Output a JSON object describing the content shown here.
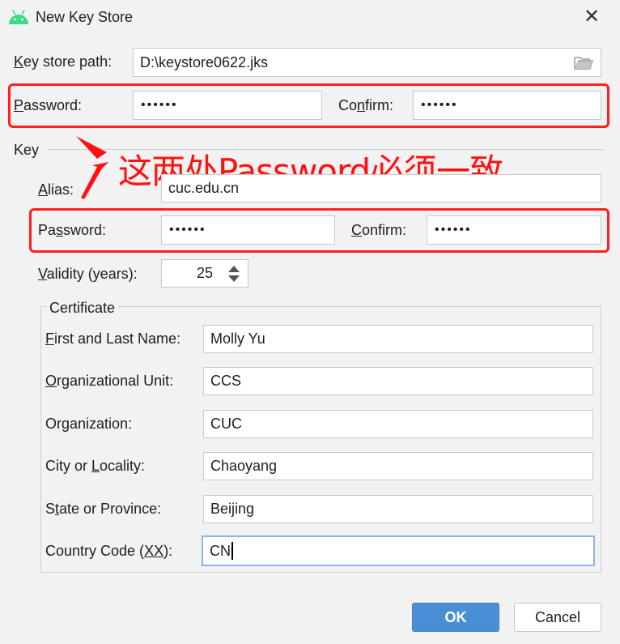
{
  "window": {
    "title": "New Key Store",
    "close_label": "✕"
  },
  "keystore": {
    "path_label": "Key store path:",
    "path_value": "D:\\keystore0622.jks",
    "password_label": "Password:",
    "password_value": "••••••",
    "confirm_label": "Confirm:",
    "confirm_value": "••••••"
  },
  "key_section": {
    "title": "Key",
    "alias_label": "Alias:",
    "alias_value": "cuc.edu.cn",
    "password_label": "Password:",
    "password_value": "••••••",
    "confirm_label": "Confirm:",
    "confirm_value": "••••••",
    "validity_label": "Validity (years):",
    "validity_value": "25"
  },
  "annotation": {
    "text": "这两处Password必须一致",
    "color": "#ff1111"
  },
  "certificate": {
    "title": "Certificate",
    "first_last_label": "First and Last Name:",
    "first_last_value": "Molly Yu",
    "org_unit_label": "Organizational Unit:",
    "org_unit_value": "CCS",
    "org_label": "Organization:",
    "org_value": "CUC",
    "city_label": "City or Locality:",
    "city_value": "Chaoyang",
    "state_label": "State or Province:",
    "state_value": "Beijing",
    "country_label": "Country Code (XX):",
    "country_value": "CN"
  },
  "buttons": {
    "ok": "OK",
    "cancel": "Cancel"
  },
  "colors": {
    "accent": "#4a8fd6",
    "highlight": "#ff1f1f",
    "android": "#3ddc84"
  }
}
